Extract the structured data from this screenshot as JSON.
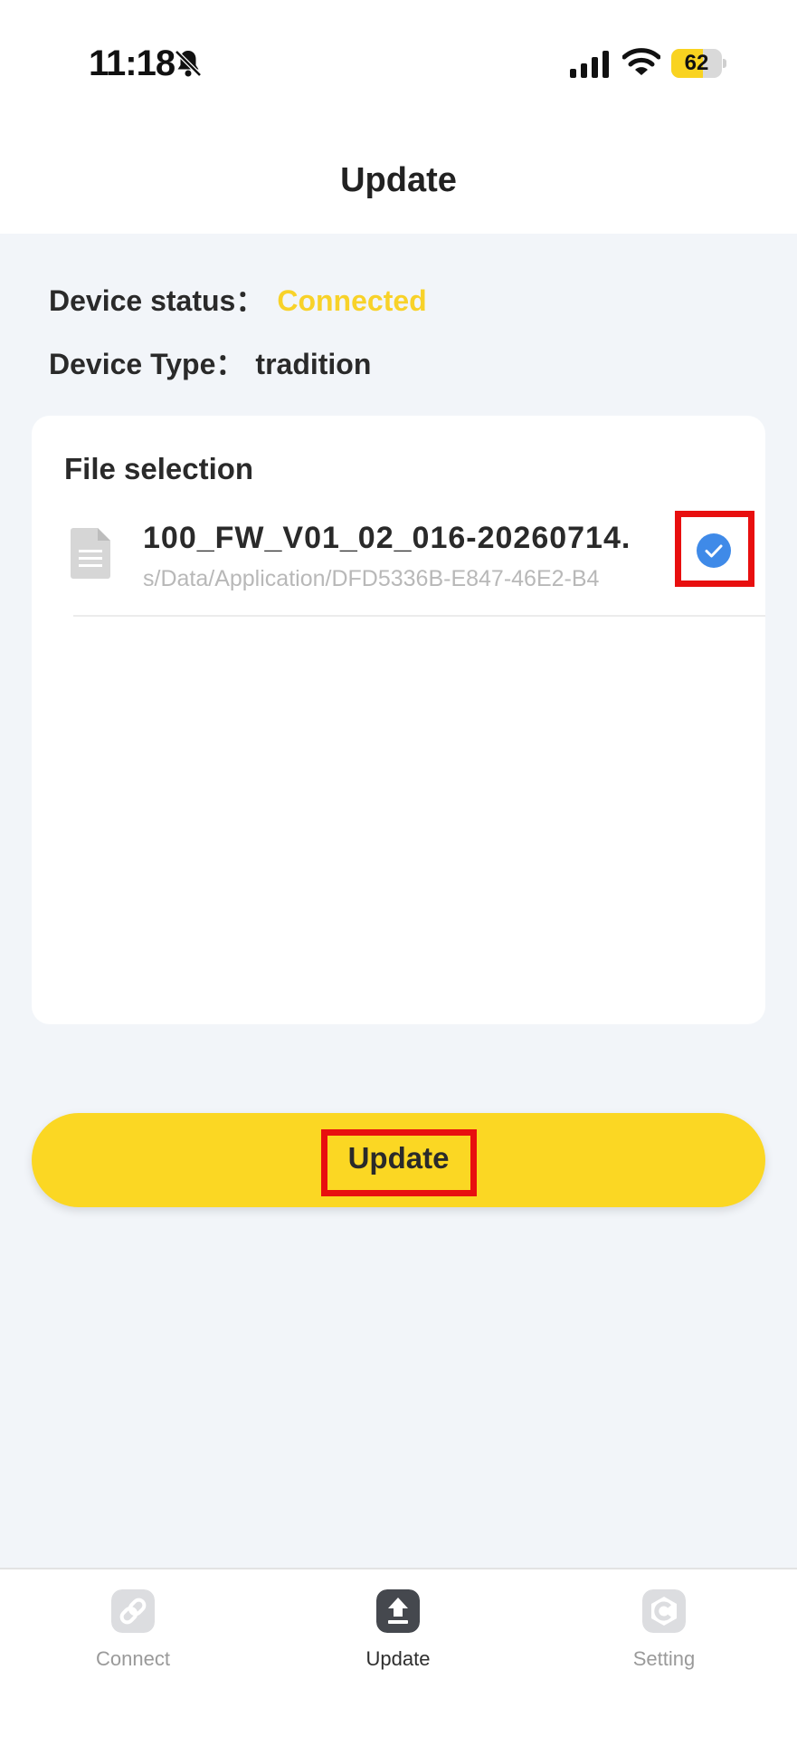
{
  "status_bar": {
    "time": "11:18",
    "battery": "62",
    "battery_level": 0.62
  },
  "header": {
    "title": "Update"
  },
  "device": {
    "status_label": "Device status：",
    "status_value": "Connected",
    "type_label": "Device Type：",
    "type_value": "tradition"
  },
  "file_selection": {
    "title": "File selection",
    "files": [
      {
        "name": "100_FW_V01_02_016-20260714.",
        "path": "s/Data/Application/DFD5336B-E847-46E2-B4",
        "selected": true
      }
    ]
  },
  "update_button": {
    "label": "Update"
  },
  "tabbar": {
    "tabs": [
      {
        "label": "Connect",
        "icon": "link-icon",
        "active": false
      },
      {
        "label": "Update",
        "icon": "upload-icon",
        "active": true
      },
      {
        "label": "Setting",
        "icon": "c-logo-icon",
        "active": false
      }
    ]
  },
  "colors": {
    "accent_yellow": "#fbd723",
    "connected_text": "#f8d229",
    "check_blue": "#3f8ae8",
    "highlight_red": "#e80f0f"
  }
}
